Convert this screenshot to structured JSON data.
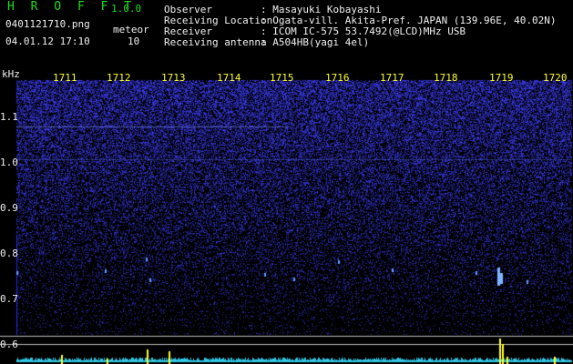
{
  "header": {
    "app_title": "H R O F F T",
    "app_version": "1.0.0",
    "filename": "0401121710.png",
    "meteor_label": "meteor",
    "datetime": "04.01.12 17:10",
    "meteor_count": "10"
  },
  "station": [
    {
      "label": "Observer",
      "value": ": Masayuki Kobayashi"
    },
    {
      "label": "Receiving Location",
      "value": ": Ogata-vill. Akita-Pref. JAPAN (139.96E, 40.02N)"
    },
    {
      "label": "Receiver",
      "value": ": ICOM IC-575 53.7492(@LCD)MHz USB"
    },
    {
      "label": "Receiving antenna",
      "value": ": A504HB(yagi 4el)"
    }
  ],
  "spectrogram": {
    "unit_label": "kHz",
    "time_ticks": [
      "1711",
      "1712",
      "1713",
      "1714",
      "1715",
      "1716",
      "1717",
      "1718",
      "1719",
      "1720"
    ],
    "freq_ticks": [
      "1.1",
      "1.0",
      "0.9",
      "0.8",
      "0.7",
      "0.6"
    ],
    "colors": {
      "background": "#000000",
      "noise": "#2a2ae0",
      "signal": "#5fa0ff",
      "meteor": "#ffff28",
      "level": "#30c8e6"
    }
  }
}
